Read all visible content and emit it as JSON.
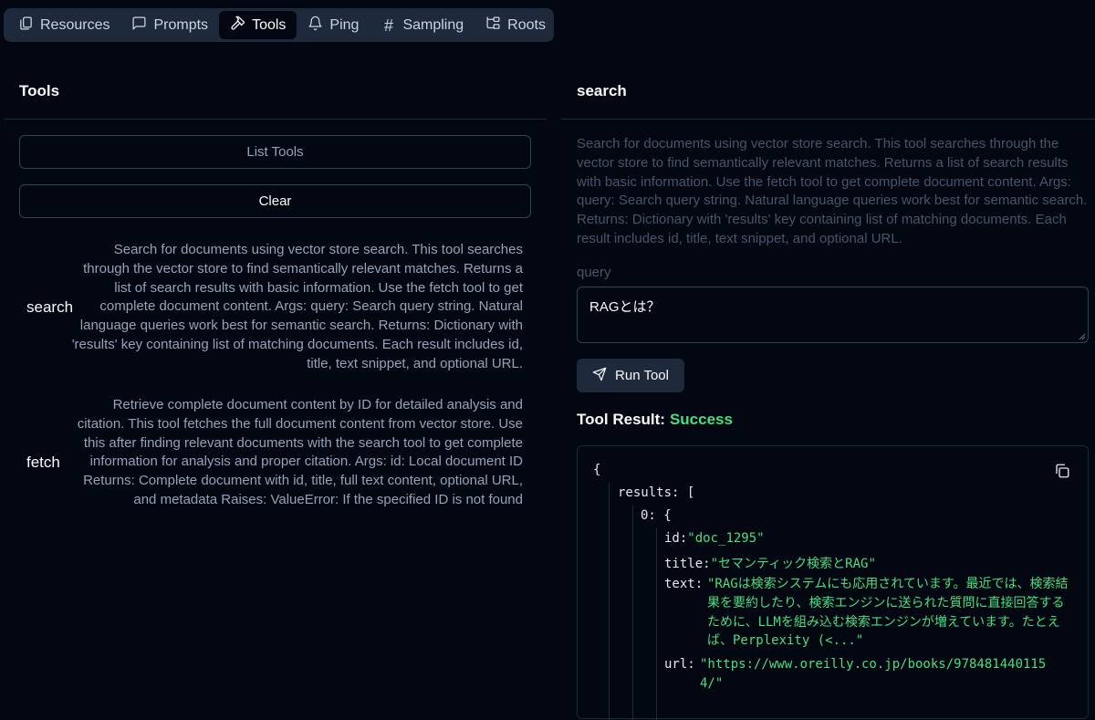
{
  "tabs": [
    {
      "label": "Resources",
      "icon": "files-icon"
    },
    {
      "label": "Prompts",
      "icon": "message-square-icon"
    },
    {
      "label": "Tools",
      "icon": "hammer-icon",
      "active": true
    },
    {
      "label": "Ping",
      "icon": "bell-icon"
    },
    {
      "label": "Sampling",
      "icon": "hash-icon"
    },
    {
      "label": "Roots",
      "icon": "folder-tree-icon"
    }
  ],
  "left": {
    "title": "Tools",
    "list_button": "List Tools",
    "clear_button": "Clear",
    "tools": [
      {
        "name": "search",
        "description": "Search for documents using vector store search. This tool searches through the vector store to find semantically relevant matches. Returns a list of search results with basic information. Use the fetch tool to get complete document content. Args: query: Search query string. Natural language queries work best for semantic search. Returns: Dictionary with 'results' key containing list of matching documents. Each result includes id, title, text snippet, and optional URL."
      },
      {
        "name": "fetch",
        "description": "Retrieve complete document content by ID for detailed analysis and citation. This tool fetches the full document content from vector store. Use this after finding relevant documents with the search tool to get complete information for analysis and proper citation. Args: id: Local document ID Returns: Complete document with id, title, full text content, optional URL, and metadata Raises: ValueError: If the specified ID is not found"
      }
    ]
  },
  "right": {
    "title": "search",
    "description": "Search for documents using vector store search. This tool searches through the vector store to find semantically relevant matches. Returns a list of search results with basic information. Use the fetch tool to get complete document content. Args: query: Search query string. Natural language queries work best for semantic search. Returns: Dictionary with 'results' key containing list of matching documents. Each result includes id, title, text snippet, and optional URL.",
    "query_label": "query",
    "query_value": "RAGとは？",
    "run_button": "Run Tool",
    "result_label": "Tool Result:",
    "result_status": "Success",
    "colors": {
      "success": "#4ade80",
      "background": "#030712",
      "border": "#1e293b"
    },
    "json": {
      "open_brace": "{",
      "results_key": "results:",
      "results_open": "[",
      "index_key": "0:",
      "index_open": "{",
      "id_key": "id:",
      "id_value": "\"doc_1295\"",
      "title_key": "title:",
      "title_value": "\"セマンティック検索とRAG\"",
      "text_key": "text:",
      "text_value": "\"RAGは検索システムにも応用されています。最近では、検索結果を要約したり、検索エンジンに送られた質問に直接回答するために、LLMを組み込む検索エンジンが増えています。たとえば、Perplexity (<...\"",
      "url_key": "url:",
      "url_value": "\"https://www.oreilly.co.jp/books/9784814401154/\""
    }
  }
}
